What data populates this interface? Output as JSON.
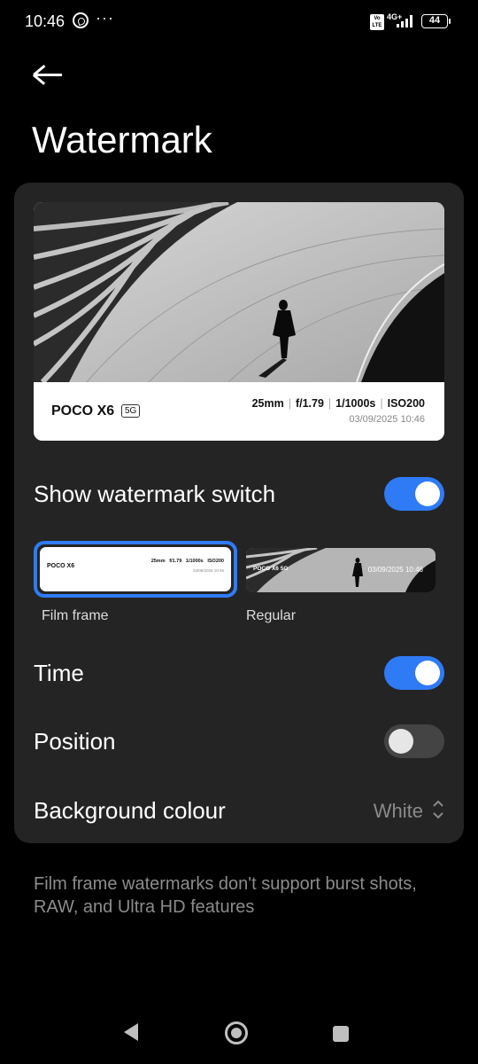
{
  "status_bar": {
    "time": "10:46",
    "volte": "Vo LTE",
    "network": "4G+",
    "battery": "44"
  },
  "header": {
    "title": "Watermark"
  },
  "preview": {
    "brand": "POCO X6",
    "badge": "5G",
    "specs": [
      "25mm",
      "f/1.79",
      "1/1000s",
      "ISO200"
    ],
    "date": "03/09/2025 10:46"
  },
  "settings": {
    "show_watermark": {
      "label": "Show watermark switch",
      "enabled": true
    },
    "styles": [
      {
        "label": "Film frame",
        "selected": true
      },
      {
        "label": "Regular",
        "selected": false
      }
    ],
    "regular_preview": {
      "brand": "POCO X6 5G",
      "date": "03/09/2025 10:46"
    },
    "time": {
      "label": "Time",
      "enabled": true
    },
    "position": {
      "label": "Position",
      "enabled": false
    },
    "background_colour": {
      "label": "Background colour",
      "value": "White"
    }
  },
  "footnote": "Film frame watermarks don't support burst shots, RAW, and Ultra HD features",
  "colors": {
    "accent": "#2f7bf6",
    "card": "#242424",
    "background": "#000000"
  }
}
